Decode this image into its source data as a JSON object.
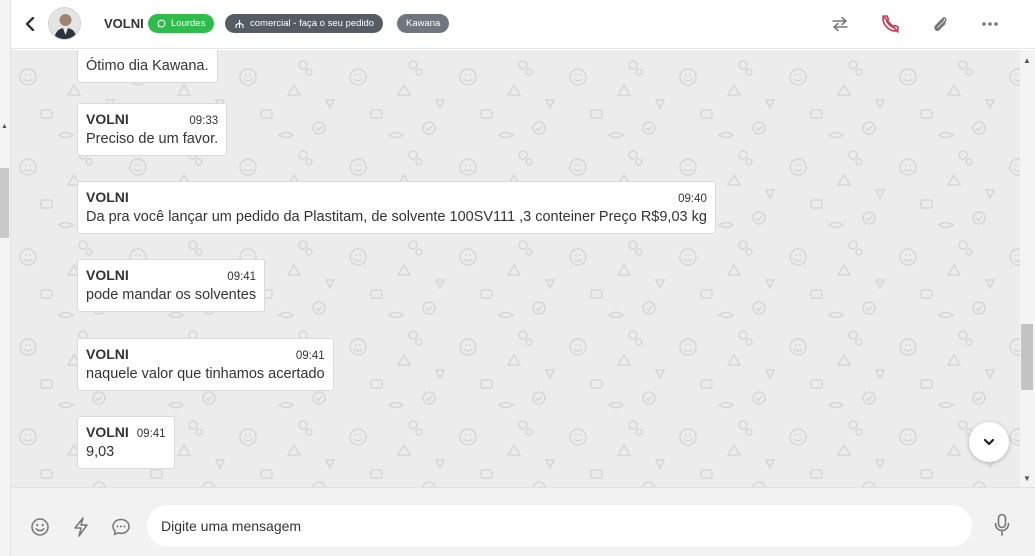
{
  "header": {
    "contact_name": "VOLNI",
    "tags": {
      "whatsapp": "Lourdes",
      "queue": "comercial - faça o seu pedido",
      "user": "Kawana"
    }
  },
  "messages": [
    {
      "sender": "",
      "time": "",
      "text": "Ótimo dia Kawana."
    },
    {
      "sender": "VOLNI",
      "time": "09:33",
      "text": "Preciso de um favor."
    },
    {
      "sender": "VOLNI",
      "time": "09:40",
      "text": "Da pra você lançar um pedido da Plastitam, de solvente 100SV111 ,3 conteiner Preço R$9,03 kg"
    },
    {
      "sender": "VOLNI",
      "time": "09:41",
      "text": "pode mandar os solventes"
    },
    {
      "sender": "VOLNI",
      "time": "09:41",
      "text": "naquele valor que tinhamos acertado"
    },
    {
      "sender": "VOLNI",
      "time": "09:41",
      "text": "9,03"
    }
  ],
  "composer": {
    "placeholder": "Digite uma mensagem"
  },
  "colors": {
    "whatsapp_tag": "#2ebd4c",
    "queue_tag": "#555c63",
    "user_tag": "#6f767d",
    "hangup_icon": "#d1344e",
    "chat_background": "#ececec"
  },
  "icons": {
    "back": "chevron-left-icon",
    "transfer": "transfer-arrows-icon",
    "close_ticket": "phone-hangup-icon",
    "attach": "paperclip-icon",
    "more": "more-dots-icon",
    "emoji": "smiley-icon",
    "quick_reply": "flash-icon",
    "chat_options": "chat-bubble-icon",
    "mic": "microphone-icon",
    "scroll_down": "chevron-down-icon"
  }
}
